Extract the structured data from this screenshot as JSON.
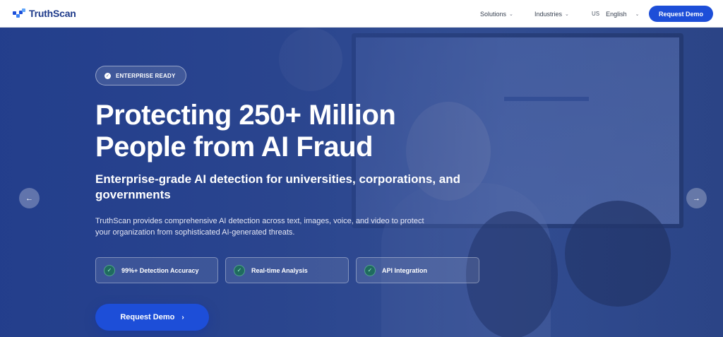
{
  "nav": {
    "logo_text": "TruthScan",
    "solutions_label": "Solutions",
    "industries_label": "Industries",
    "lang_code": "US",
    "lang_label": "English",
    "demo_label": "Request Demo"
  },
  "hero": {
    "badge": "ENTERPRISE READY",
    "title_line1": "Protecting 250+ Million",
    "title_line2": "People from AI Fraud",
    "subtitle": "Enterprise-grade AI detection for universities, corporations, and governments",
    "description": "TruthScan provides comprehensive AI detection across text, images, voice, and video to protect your organization from sophisticated AI-generated threats.",
    "features": [
      {
        "label": "99%+ Detection Accuracy"
      },
      {
        "label": "Real-time Analysis"
      },
      {
        "label": "API Integration"
      }
    ],
    "cta_label": "Request Demo"
  },
  "icons": {
    "check": "✓",
    "chevron_down": "⌄",
    "arrow_left": "←",
    "arrow_right": "→",
    "chevron_right": "›"
  },
  "colors": {
    "brand": "#1d4ed8",
    "hero_bg": "#2e4c95"
  }
}
